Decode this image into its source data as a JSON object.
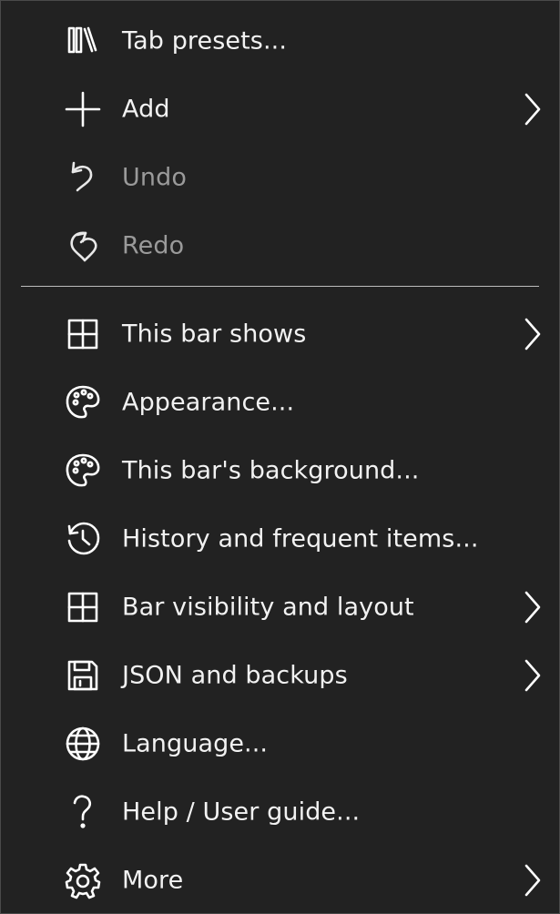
{
  "menu": {
    "items": [
      {
        "label": "Tab presets...",
        "icon": "library-icon",
        "submenu": false,
        "disabled": false
      },
      {
        "label": "Add",
        "icon": "plus-icon",
        "submenu": true,
        "disabled": false
      },
      {
        "label": "Undo",
        "icon": "undo-icon",
        "submenu": false,
        "disabled": true
      },
      {
        "label": "Redo",
        "icon": "redo-icon",
        "submenu": false,
        "disabled": true
      },
      {
        "label": "This bar shows",
        "icon": "grid-icon",
        "submenu": true,
        "disabled": false
      },
      {
        "label": "Appearance...",
        "icon": "palette-icon",
        "submenu": false,
        "disabled": false
      },
      {
        "label": "This bar's background...",
        "icon": "palette-icon",
        "submenu": false,
        "disabled": false
      },
      {
        "label": "History and frequent items...",
        "icon": "history-icon",
        "submenu": false,
        "disabled": false
      },
      {
        "label": "Bar visibility and layout",
        "icon": "grid-icon",
        "submenu": true,
        "disabled": false
      },
      {
        "label": "JSON and backups",
        "icon": "save-icon",
        "submenu": true,
        "disabled": false
      },
      {
        "label": "Language...",
        "icon": "globe-icon",
        "submenu": false,
        "disabled": false
      },
      {
        "label": "Help / User guide...",
        "icon": "question-icon",
        "submenu": false,
        "disabled": false
      },
      {
        "label": "More",
        "icon": "gear-icon",
        "submenu": true,
        "disabled": false
      }
    ]
  },
  "colors": {
    "background": "#222222",
    "text": "#f2f2f2",
    "disabled_text": "#9a9a9a",
    "separator": "#bdbdbd"
  }
}
